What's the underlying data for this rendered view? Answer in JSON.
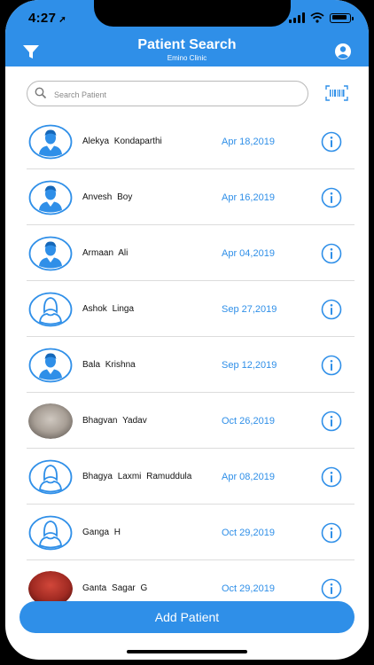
{
  "status": {
    "time": "4:27"
  },
  "header": {
    "title": "Patient Search",
    "subtitle": "Emino Clinic"
  },
  "search": {
    "placeholder": "Search Patient",
    "value": ""
  },
  "patients": [
    {
      "name": "Alekya  Kondaparthi",
      "date": "Apr 18,2019",
      "avatar": "male-icon"
    },
    {
      "name": "Anvesh  Boy",
      "date": "Apr 16,2019",
      "avatar": "male-icon"
    },
    {
      "name": "Armaan  Ali",
      "date": "Apr 04,2019",
      "avatar": "male-icon"
    },
    {
      "name": "Ashok  Linga",
      "date": "Sep 27,2019",
      "avatar": "female-icon"
    },
    {
      "name": "Bala  Krishna",
      "date": "Sep 12,2019",
      "avatar": "male-icon"
    },
    {
      "name": "Bhagvan  Yadav",
      "date": "Oct 26,2019",
      "avatar": "photo-gray"
    },
    {
      "name": "Bhagya Laxmi Ramuddula",
      "date": "Apr 08,2019",
      "avatar": "female-icon"
    },
    {
      "name": "Ganga  H",
      "date": "Oct 29,2019",
      "avatar": "female-icon"
    },
    {
      "name": "Ganta Sagar  G",
      "date": "Oct 29,2019",
      "avatar": "photo-red"
    }
  ],
  "footer": {
    "add_label": "Add Patient"
  },
  "colors": {
    "accent": "#2f8fe8",
    "divider": "#dcdcdc"
  }
}
